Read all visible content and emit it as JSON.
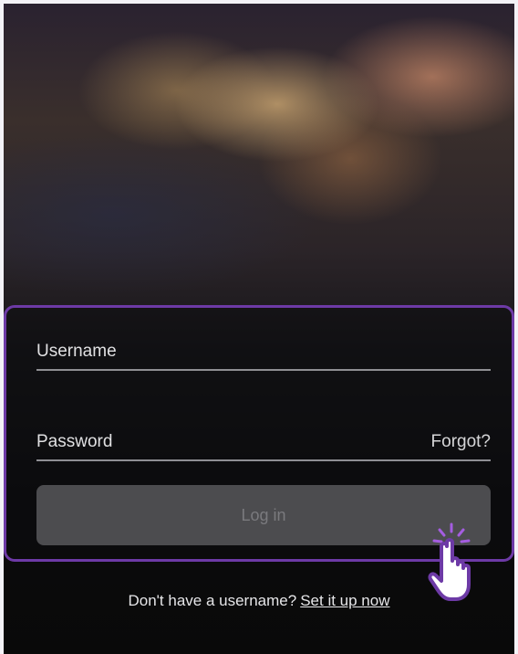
{
  "login": {
    "username_label": "Username",
    "password_label": "Password",
    "forgot_label": "Forgot?",
    "button_label": "Log in"
  },
  "signup": {
    "prompt": "Don't have a username?",
    "link": "Set it up now"
  },
  "colors": {
    "highlight_border": "#6d3aa6",
    "button_bg": "#4c4c4f"
  },
  "icons": {
    "pointer": "hand-cursor-icon"
  }
}
